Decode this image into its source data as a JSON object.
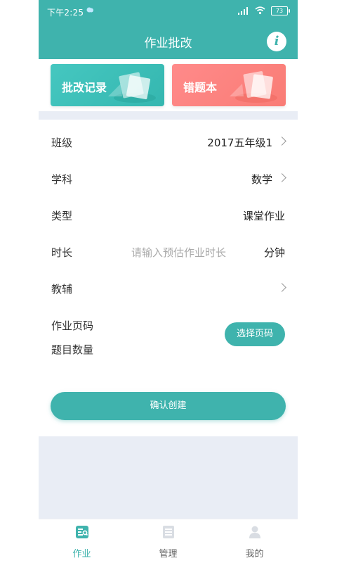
{
  "status": {
    "time": "下午2:25",
    "battery": "73"
  },
  "header": {
    "title": "作业批改",
    "info_label": "i"
  },
  "cards": [
    {
      "label": "批改记录"
    },
    {
      "label": "错题本"
    }
  ],
  "form": {
    "class": {
      "label": "班级",
      "value": "2017五年级1"
    },
    "subject": {
      "label": "学科",
      "value": "数学"
    },
    "type": {
      "label": "类型",
      "value": "课堂作业"
    },
    "duration": {
      "label": "时长",
      "placeholder": "请输入预估作业时长",
      "unit": "分钟"
    },
    "tutor": {
      "label": "教辅",
      "value": ""
    },
    "pages_label": "作业页码",
    "count_label": "题目数量",
    "select_button": "选择页码",
    "confirm_button": "确认创建"
  },
  "tabs": [
    {
      "label": "作业",
      "active": true
    },
    {
      "label": "管理",
      "active": false
    },
    {
      "label": "我的",
      "active": false
    }
  ],
  "colors": {
    "accent": "#3fb3ad",
    "card_red": "#f97c75",
    "background_gray": "#e9edf5"
  }
}
